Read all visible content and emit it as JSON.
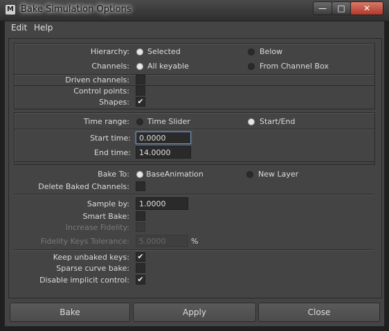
{
  "window": {
    "title": "Bake Simulation Options",
    "icon": "maya-app-icon"
  },
  "window_controls": {
    "minimize": "—",
    "maximize": "□",
    "close": "✕"
  },
  "menu": [
    "Edit",
    "Help"
  ],
  "hierarchy": {
    "label": "Hierarchy:",
    "options": [
      "Selected",
      "Below"
    ],
    "selected": "Selected"
  },
  "channels": {
    "label": "Channels:",
    "options": [
      "All keyable",
      "From Channel Box"
    ],
    "selected": "All keyable"
  },
  "driven_channels": {
    "label": "Driven channels:",
    "checked": false
  },
  "control_points": {
    "label": "Control points:",
    "checked": false
  },
  "shapes": {
    "label": "Shapes:",
    "checked": true
  },
  "time_range": {
    "label": "Time range:",
    "options": [
      "Time Slider",
      "Start/End"
    ],
    "selected": "Start/End"
  },
  "start_time": {
    "label": "Start time:",
    "value": "0.0000"
  },
  "end_time": {
    "label": "End time:",
    "value": "14.0000"
  },
  "bake_to": {
    "label": "Bake To:",
    "options": [
      "BaseAnimation",
      "New Layer"
    ],
    "selected": "BaseAnimation"
  },
  "delete_baked": {
    "label": "Delete Baked Channels:",
    "checked": false
  },
  "sample_by": {
    "label": "Sample by:",
    "value": "1.0000"
  },
  "smart_bake": {
    "label": "Smart Bake:",
    "checked": false
  },
  "increase_fidelity": {
    "label": "Increase Fidelity:",
    "checked": false,
    "disabled": true
  },
  "fidelity_tolerance": {
    "label": "Fidelity Keys Tolerance:",
    "value": "5.0000",
    "unit": "%",
    "disabled": true
  },
  "keep_unbaked": {
    "label": "Keep unbaked keys:",
    "checked": true
  },
  "sparse_curve": {
    "label": "Sparse curve bake:",
    "checked": false
  },
  "disable_implicit": {
    "label": "Disable implicit control:",
    "checked": true
  },
  "buttons": {
    "bake": "Bake",
    "apply": "Apply",
    "close": "Close"
  },
  "check_glyph": "✔"
}
